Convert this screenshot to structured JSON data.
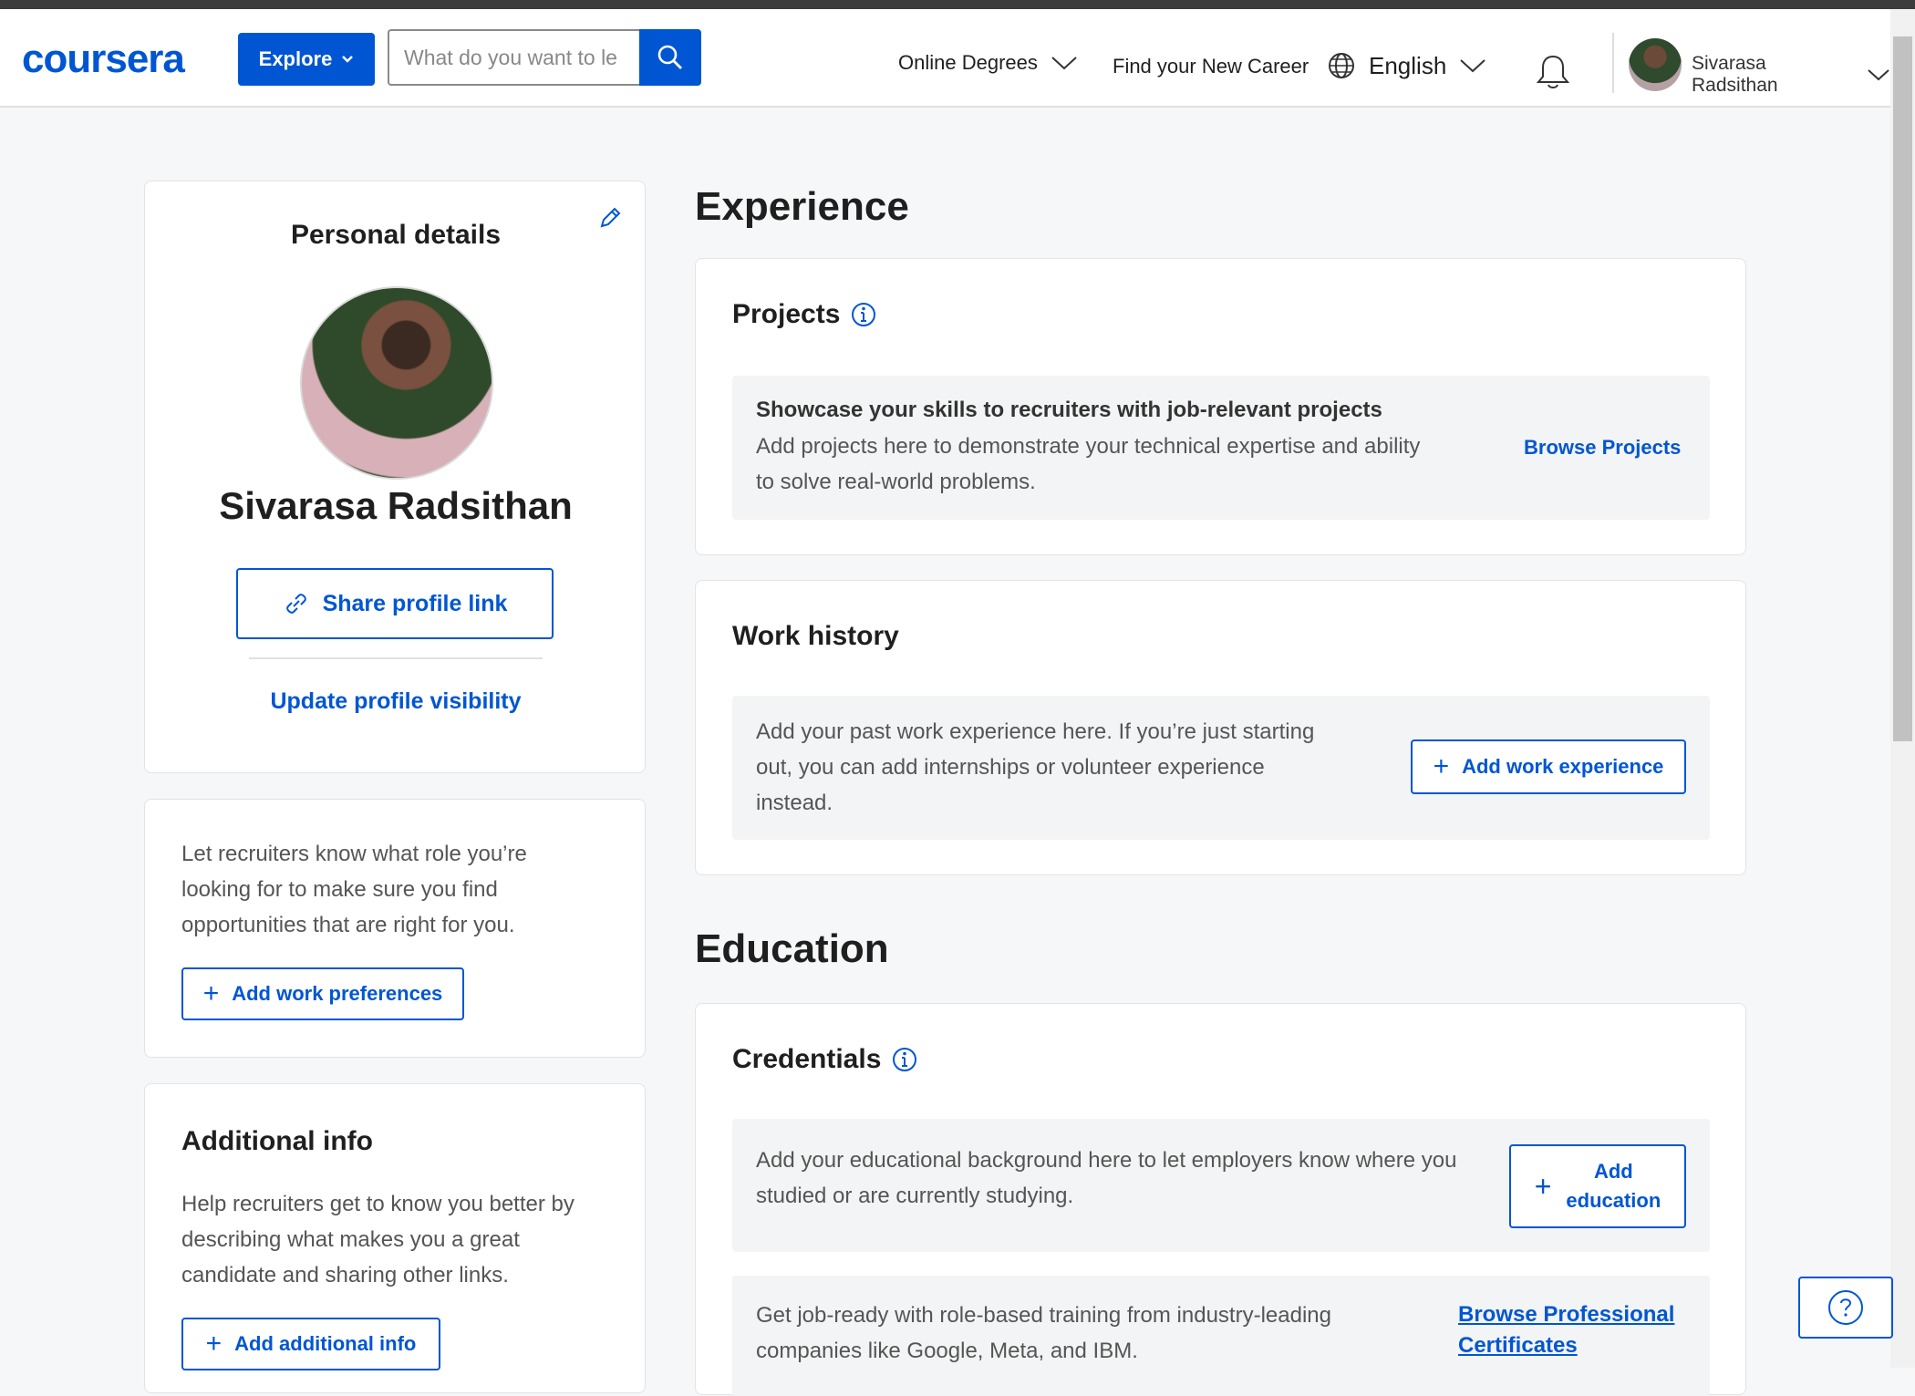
{
  "header": {
    "logo": "coursera",
    "explore_label": "Explore",
    "search_placeholder": "What do you want to le",
    "nav_degrees": "Online Degrees",
    "nav_career": "Find your New Career",
    "language": "English",
    "username": "Sivarasa Radsithan"
  },
  "personal": {
    "title": "Personal details",
    "name": "Sivarasa Radsithan",
    "share_label": "Share profile link",
    "visibility_label": "Update profile visibility"
  },
  "prefs": {
    "text_lines": [
      "Let recruiters know what role you’re",
      "looking for to make sure you find",
      "opportunities that are right for you."
    ],
    "button_label": "Add work preferences"
  },
  "additional": {
    "title": "Additional info",
    "text_lines": [
      "Help recruiters get to know you better by",
      "describing what makes you a great",
      "candidate and sharing other links."
    ],
    "button_label": "Add additional info"
  },
  "experience": {
    "title": "Experience",
    "projects": {
      "title": "Projects",
      "headline": "Showcase your skills to recruiters with job-relevant projects",
      "text_lines": [
        "Add projects here to demonstrate your technical expertise and ability",
        "to solve real-world problems."
      ],
      "link": "Browse Projects"
    },
    "work": {
      "title": "Work history",
      "text_lines": [
        "Add your past work experience here. If you’re just starting",
        "out, you can add internships or volunteer experience",
        "instead."
      ],
      "button_label": "Add work experience"
    }
  },
  "education": {
    "title": "Education",
    "credentials": {
      "title": "Credentials",
      "text_lines": [
        "Add your educational background here to let employers know where you",
        "studied or are currently studying."
      ],
      "button_line1": "Add",
      "button_line2": "education",
      "promo_lines": [
        "Get job-ready with role-based training from industry-leading",
        "companies like Google, Meta, and IBM."
      ],
      "promo_link_line1": "Browse Professional",
      "promo_link_line2": "Certificates"
    }
  },
  "colors": {
    "brand": "#0056d2",
    "page_bg": "#f5f7f8",
    "gray_box": "#f3f4f5"
  }
}
